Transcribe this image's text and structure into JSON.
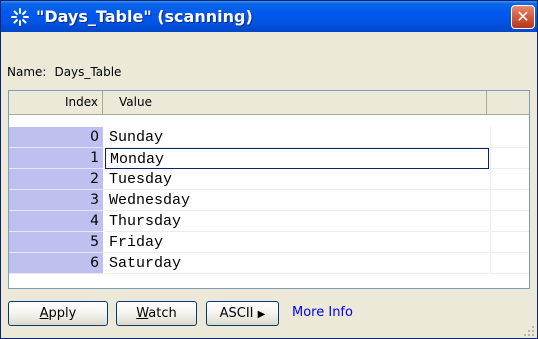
{
  "window": {
    "title": "\"Days_Table\" (scanning)",
    "close_symbol": "✕",
    "colors": {
      "titlebar": "#0054e3",
      "close": "#d25a3c",
      "index_column": "#c0c0f0",
      "face": "#ece9d8"
    }
  },
  "name_row": {
    "label": "Name:",
    "value": "Days_Table"
  },
  "table": {
    "columns": [
      "Index",
      "Value"
    ],
    "rows": [
      {
        "index": "0",
        "value": "Sunday"
      },
      {
        "index": "1",
        "value": "Monday"
      },
      {
        "index": "2",
        "value": "Tuesday"
      },
      {
        "index": "3",
        "value": "Wednesday"
      },
      {
        "index": "4",
        "value": "Thursday"
      },
      {
        "index": "5",
        "value": "Friday"
      },
      {
        "index": "6",
        "value": "Saturday"
      }
    ],
    "selected_index": "1"
  },
  "buttons": {
    "apply_mnemonic": "A",
    "apply_rest": "pply",
    "watch_mnemonic": "W",
    "watch_rest": "atch",
    "ascii_label": "ASCII",
    "ascii_arrow": "▶"
  },
  "more_info": "More Info",
  "icons": {
    "title": "sparkle-icon",
    "close": "close-icon",
    "resize": "resize-grip-icon",
    "ascii_arrow": "triangle-right-icon"
  }
}
